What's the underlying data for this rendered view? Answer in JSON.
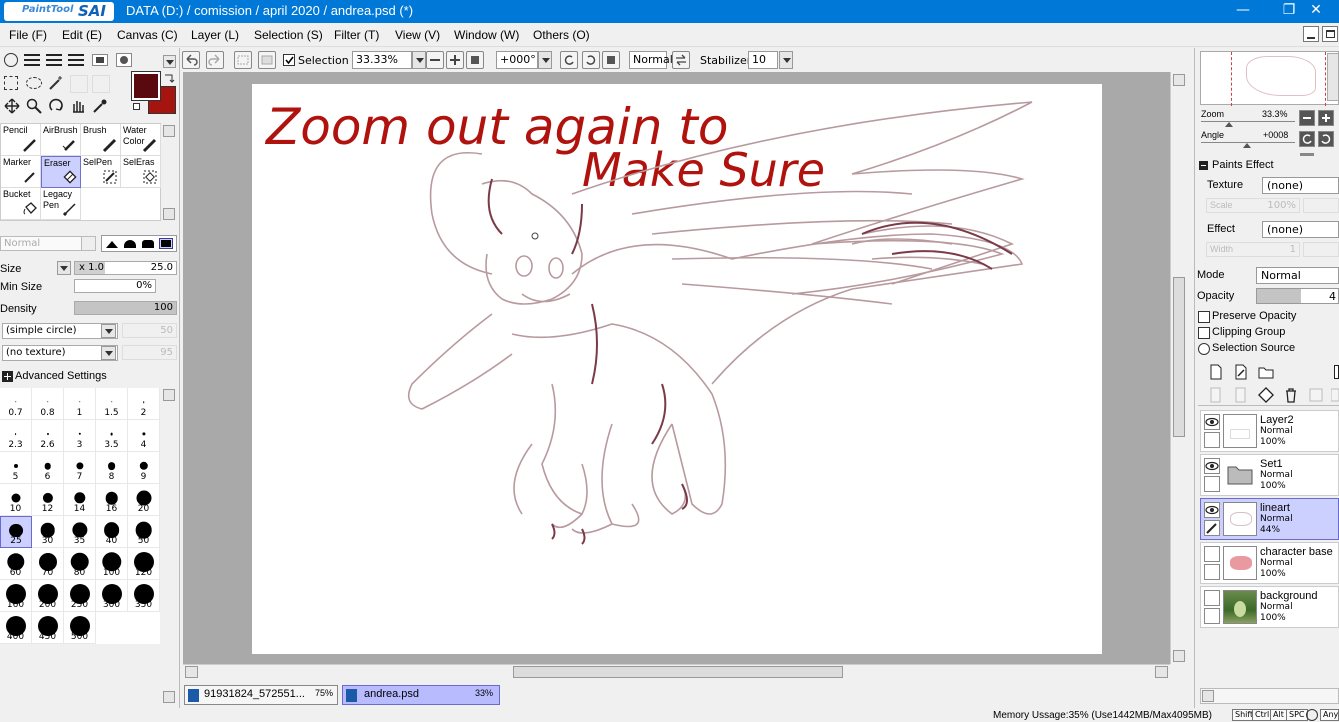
{
  "window": {
    "app_name": "PaintTool",
    "app_logo": "SAI",
    "title": "DATA (D:) / comission / april 2020 / andrea.psd (*)",
    "controls": [
      "minimize-icon",
      "restore-icon",
      "close-icon"
    ]
  },
  "menu": [
    {
      "label": "File (F)"
    },
    {
      "label": "Edit (E)"
    },
    {
      "label": "Canvas (C)"
    },
    {
      "label": "Layer (L)"
    },
    {
      "label": "Selection (S)"
    },
    {
      "label": "Filter (T)"
    },
    {
      "label": "View (V)"
    },
    {
      "label": "Window (W)"
    },
    {
      "label": "Others (O)"
    }
  ],
  "toolbar": {
    "selection_label": "Selection",
    "selection_checked": true,
    "zoom": "33.33%",
    "rotation": "+000°",
    "blend_mode": "Normal",
    "stabilizer_label": "Stabilizer",
    "stabilizer_value": "10"
  },
  "colors": {
    "primary": "#5a0a0f",
    "secondary": "#a5140f",
    "titlebar": "#0078d7",
    "selected": "#ccd0ff",
    "lineart": "#b89a9e",
    "handwriting": "#b0120d"
  },
  "tools": [
    {
      "label": "Pencil"
    },
    {
      "label": "AirBrush"
    },
    {
      "label": "Brush"
    },
    {
      "label": "Water Color"
    },
    {
      "label": "Marker"
    },
    {
      "label": "Eraser",
      "active": true
    },
    {
      "label": "SelPen"
    },
    {
      "label": "SelEras"
    },
    {
      "label": "Bucket"
    },
    {
      "label": "Legacy Pen"
    }
  ],
  "brush": {
    "blend_mode": "Normal",
    "size_label": "Size",
    "size_multiplier": "x 1.0",
    "size_value": "25.0",
    "min_size_label": "Min Size",
    "min_size_value": "0%",
    "density_label": "Density",
    "density_value": "100",
    "density_fraction": 1.0,
    "shape": "(simple circle)",
    "shape_value": "50",
    "texture": "(no texture)",
    "texture_value": "95",
    "advanced_label": "Advanced Settings"
  },
  "brush_sizes": [
    "0.7",
    "0.8",
    "1",
    "1.5",
    "2",
    "2.3",
    "2.6",
    "3",
    "3.5",
    "4",
    "5",
    "6",
    "7",
    "8",
    "9",
    "10",
    "12",
    "14",
    "16",
    "20",
    "25",
    "30",
    "35",
    "40",
    "50",
    "60",
    "70",
    "80",
    "100",
    "120",
    "160",
    "200",
    "250",
    "300",
    "350",
    "400",
    "450",
    "500"
  ],
  "brush_size_active": "25",
  "canvas": {
    "handwriting_line1": "Zoom out again to",
    "handwriting_line2": "Make Sure"
  },
  "documents": [
    {
      "name": "91931824_572551...",
      "zoom": "75%",
      "active": false
    },
    {
      "name": "andrea.psd",
      "zoom": "33%",
      "active": true
    }
  ],
  "navigator": {
    "zoom_label": "Zoom",
    "zoom_value": "33.3%",
    "angle_label": "Angle",
    "angle_value": "+0008"
  },
  "paints_effect": {
    "title": "Paints Effect",
    "texture_label": "Texture",
    "texture_value": "(none)",
    "scale_label": "Scale",
    "scale_value": "100%",
    "effect_label": "Effect",
    "effect_value": "(none)",
    "width_label": "Width",
    "width_value": "1"
  },
  "layer_props": {
    "mode_label": "Mode",
    "mode_value": "Normal",
    "opacity_label": "Opacity",
    "opacity_value": "4",
    "preserve_opacity": "Preserve Opacity",
    "clipping_group": "Clipping Group",
    "selection_source": "Selection Source"
  },
  "layers": [
    {
      "name": "Layer2",
      "mode": "Normal",
      "opacity": "100%",
      "active": false
    },
    {
      "name": "Set1",
      "mode": "Normal",
      "opacity": "100%",
      "active": false,
      "folder": true
    },
    {
      "name": "lineart",
      "mode": "Normal",
      "opacity": "44%",
      "active": true
    },
    {
      "name": "character base",
      "mode": "Normal",
      "opacity": "100%",
      "active": false
    },
    {
      "name": "background",
      "mode": "Normal",
      "opacity": "100%",
      "active": false
    }
  ],
  "status": {
    "memory": "Memory Ussage:35% (Use1442MB/Max4095MB)",
    "keys": [
      "Shift",
      "Ctrl",
      "Alt",
      "SPC",
      "Any"
    ]
  }
}
